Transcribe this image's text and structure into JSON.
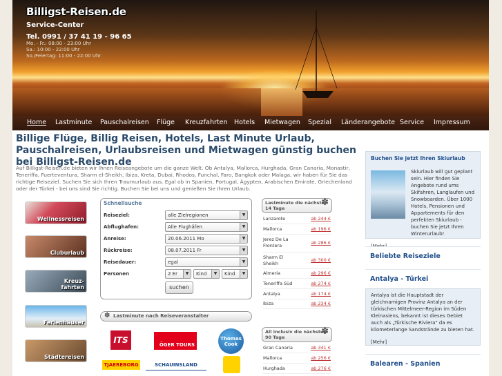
{
  "header": {
    "logo": "Billigst-Reisen.de",
    "service": "Service-Center",
    "tel": "Tel. 0991 / 37 41 19 - 96 65",
    "hours": [
      "Mo. - Fr.: 08:00 - 23:00 Uhr",
      "Sa.: 10:00 - 22:00 Uhr",
      "So./Feiertag: 11:00 - 22:00 Uhr"
    ]
  },
  "nav": [
    "Home",
    "Lastminute",
    "Pauschalreisen",
    "Flüge",
    "Kreuzfahrten",
    "Hotels",
    "Mietwagen",
    "Spezial",
    "Länderangebote",
    "Service",
    "Impressum"
  ],
  "headline": "Billige Flüge, Billig Reisen, Hotels, Last Minute Urlaub, Pauschalreisen, Urlaubsreisen und Mietwagen günstig buchen bei Billigst-Reisen.de",
  "intro": "Auf Billigst-Reisen.de bieten wir Ihnen Reiseangebote um die ganze Welt. Ob Antalya, Mallorca, Hurghada, Gran Canaria, Monastir, Teneriffa, Fuerteventura, Sharm el-Sheikh, Ibiza, Kreta, Dubai, Rhodos, Funchal, Faro, Bangkok oder Malaga, wir haben für Sie das richtige Reiseziel. Suchen Sie sich Ihren Traumurlaub aus. Egal ob in Spanien, Portugal, Ägypten, Arabischen Emirate, Griechenland oder der Türkei - bei uns sind Sie richtig. Buchen Sie bei uns und genießen Sie Ihren Urlaub.",
  "categories": [
    "Wellnessreisen",
    "Cluburlaub",
    "Kreuz-\nfahrten",
    "Ferienhäuser",
    "Städtereisen"
  ],
  "search": {
    "title": "Schnellsuche",
    "labels": [
      "Reiseziel:",
      "Abflughafen:",
      "Anreise:",
      "Rückreise:",
      "Reisedauer:",
      "Personen"
    ],
    "values": [
      "alle Zielregionen",
      "Alle Flughäfen",
      "20.06.2011 Mo",
      "08.07.2011 Fr",
      "egal"
    ],
    "persons": [
      "2 Er",
      "Kind",
      "Kind"
    ],
    "button": "suchen"
  },
  "banner": "Lastminute nach Reiseveranstalter",
  "operators": [
    "ITS",
    "ÖGER TOURS",
    "Thomas Cook",
    "TJAEREBORG",
    "SCHAUINSLAND"
  ],
  "lastminute": {
    "title": "Lastminute die nächsten 14 Tage",
    "rows": [
      [
        "Lanzarote",
        "ab 244 €"
      ],
      [
        "Mallorca",
        "ab 196 €"
      ],
      [
        "Jerez De La Frontera",
        "ab 286 €"
      ],
      [
        "Sharm El Sheikh",
        "ab 300 €"
      ],
      [
        "Almeria",
        "ab 296 €"
      ],
      [
        "Teneriffa Süd",
        "ab 274 €"
      ],
      [
        "Antalya",
        "ab 174 €"
      ],
      [
        "Ibiza",
        "ab 234 €"
      ]
    ]
  },
  "allinclusive": {
    "title": "All inclusiv die nächsten 90 Tage",
    "rows": [
      [
        "Gran Canaria",
        "ab 341 €"
      ],
      [
        "Mallorca",
        "ab 256 €"
      ],
      [
        "Hurghada",
        "ab 276 €"
      ]
    ]
  },
  "ski": {
    "title": "Buchen Sie jetzt Ihren Skiurlaub",
    "text": "Skiurlaub will gut geplant sein. Hier finden Sie Angebote rund ums Skifahren, Langlaufen und Snowboarden. Über 1000 Hotels, Pensionen und Appartements für den perfekten Skiurlaub - buchen Sie jetzt Ihren Winterurlaub!",
    "more": "[Mehr]"
  },
  "beliebte": "Beliebte Reiseziele",
  "antalya": {
    "title": "Antalya - Türkei",
    "text": "Antalya ist die Hauptstadt der gleichnamigen Provinz Antalya an der türkischen Mittelmeer-Region im Süden Kleinasiens, bekannt ist dieses Gebiet auch als „Türkische Riviera\" da es kilometerlange Sandstrände zu bieten hat.",
    "more": "[Mehr]"
  },
  "balearen": "Balearen - Spanien"
}
